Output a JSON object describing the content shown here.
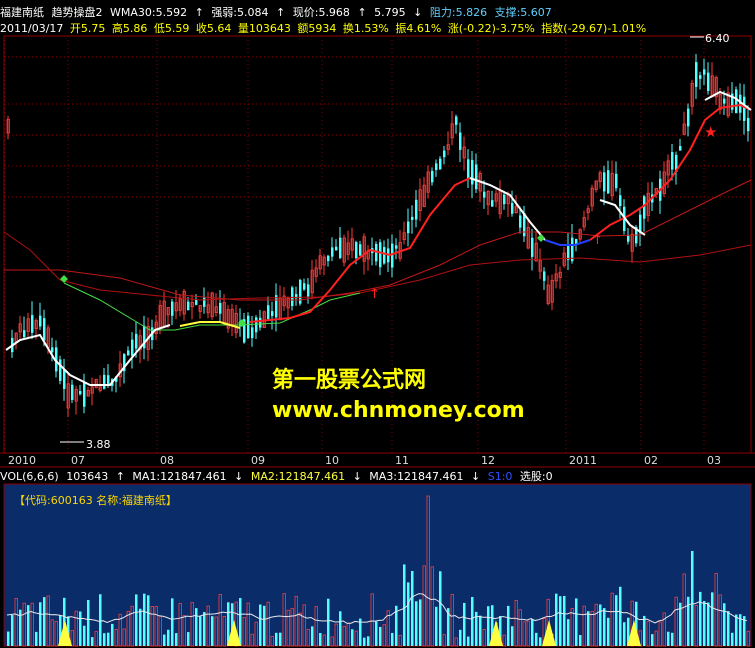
{
  "header": {
    "stock_name": "福建南纸",
    "indicator": "趋势操盘2",
    "wma30": "WMA30:5.592",
    "strength": "强弱:5.084",
    "price_now": "现价:5.968",
    "price_down": "5.795",
    "resistance": "阻力:5.826",
    "support": "支撑:5.607"
  },
  "quote": {
    "date": "2011/03/17",
    "open": "开5.75",
    "high": "高5.86",
    "low": "低5.59",
    "close": "收5.64",
    "volume": "量103643",
    "amount": "额5934",
    "turnover": "换1.53%",
    "amplitude": "振4.61%",
    "change": "涨(-0.22)-3.75%",
    "index": "指数(-29.67)-1.01%"
  },
  "price_markers": {
    "high": "6.40",
    "low": "3.88"
  },
  "time_axis": [
    "2010",
    "07",
    "08",
    "09",
    "10",
    "11",
    "12",
    "2011",
    "02",
    "03"
  ],
  "volume_header": {
    "name": "VOL(6,6,6)",
    "vol": "103643",
    "ma1": "MA1:121847.461",
    "ma2": "MA2:121847.461",
    "ma3": "MA3:121847.461",
    "v4": "S1:0",
    "pick": "选股:0"
  },
  "code_label": "【代码:600163 名称:福建南纸】",
  "watermark": {
    "line1": "第一股票公式网",
    "line2": "www.chnmoney.com"
  },
  "colors": {
    "up": "#ff3a3a",
    "down": "#54ffff",
    "grid": "#8b0000",
    "wma_white": "#ffffff",
    "red_line": "#ff2020",
    "green_line": "#44dd44",
    "yellow_line": "#ffff40",
    "blue_line": "#2040ff",
    "watermark": "#ffff00"
  },
  "chart_data": {
    "type": "candlestick",
    "title": "福建南纸 趋势操盘2",
    "price_range": [
      3.88,
      6.4
    ],
    "x_labels": [
      "2010",
      "07",
      "08",
      "09",
      "10",
      "11",
      "12",
      "2011",
      "02",
      "03"
    ],
    "series": [
      {
        "name": "WMA30",
        "last": 5.592
      },
      {
        "name": "强弱",
        "last": 5.084
      },
      {
        "name": "阻力",
        "last": 5.826
      },
      {
        "name": "支撑",
        "last": 5.607
      }
    ],
    "volume": {
      "last": 103643,
      "ma": 121847.461
    }
  }
}
